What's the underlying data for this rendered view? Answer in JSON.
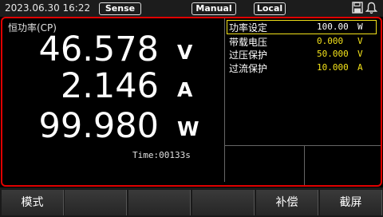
{
  "status": {
    "datetime": "2023.06.30 16:22",
    "sense_label": "Sense",
    "manual_label": "Manual",
    "local_label": "Local",
    "icons": [
      "save-icon",
      "bell-icon"
    ]
  },
  "main": {
    "mode_title": "恒功率(CP)",
    "readings": [
      {
        "value": "46.578",
        "unit": "V"
      },
      {
        "value": "2.146",
        "unit": "A"
      },
      {
        "value": "99.980",
        "unit": "W"
      }
    ],
    "time_text": "Time:00133s"
  },
  "params": [
    {
      "label": "功率设定",
      "value": "100.00",
      "unit": "W"
    },
    {
      "label": "带载电压",
      "value": "0.000",
      "unit": "V"
    },
    {
      "label": "过压保护",
      "value": "50.000",
      "unit": "V"
    },
    {
      "label": "过流保护",
      "value": "10.000",
      "unit": "A"
    }
  ],
  "softkeys": [
    "模式",
    "",
    "",
    "",
    "补偿",
    "截屏"
  ],
  "colors": {
    "accent_red": "#e00000",
    "value_yellow": "#f3e21a"
  }
}
